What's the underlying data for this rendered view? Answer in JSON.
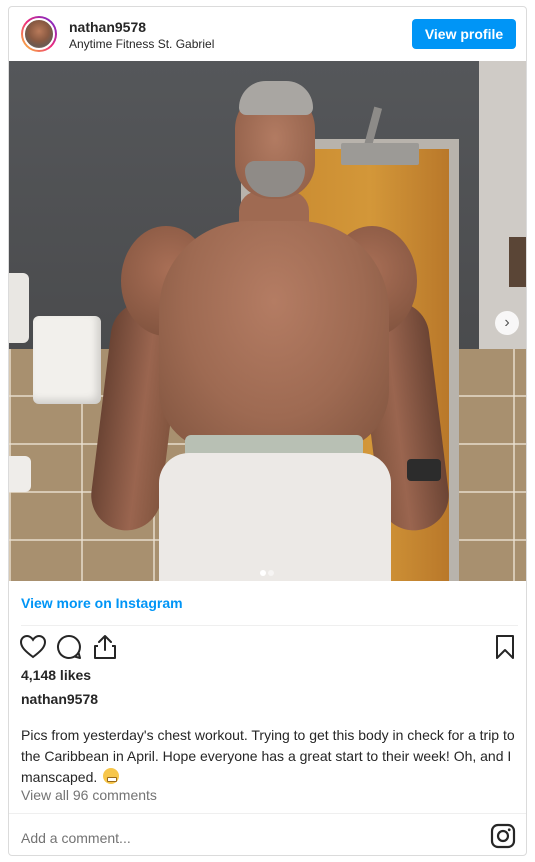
{
  "post": {
    "username": "nathan9578",
    "location": "Anytime Fitness St. Gabriel",
    "view_profile_label": "View profile",
    "view_more_label": "View more on Instagram",
    "likes": "4,148 likes",
    "owner": "nathan9578",
    "caption": "Pics from yesterday's chest workout. Trying to get this body in check for a trip to the Caribbean in April. Hope everyone has a great start to their week! Oh, and I manscaped.",
    "caption_emoji": "grimacing-face-emoji",
    "view_comments": "View all 96 comments",
    "add_comment_placeholder": "Add a comment...",
    "carousel": {
      "total": 2,
      "active_index": 0
    }
  },
  "icons": {
    "like": "heart-icon",
    "comment": "comment-icon",
    "share": "share-icon",
    "save": "bookmark-icon",
    "next": "chevron-right-icon",
    "instagram": "instagram-icon"
  },
  "colors": {
    "accent": "#0095f6",
    "text": "#262626",
    "muted": "#737373",
    "border": "#dbdbdb"
  }
}
